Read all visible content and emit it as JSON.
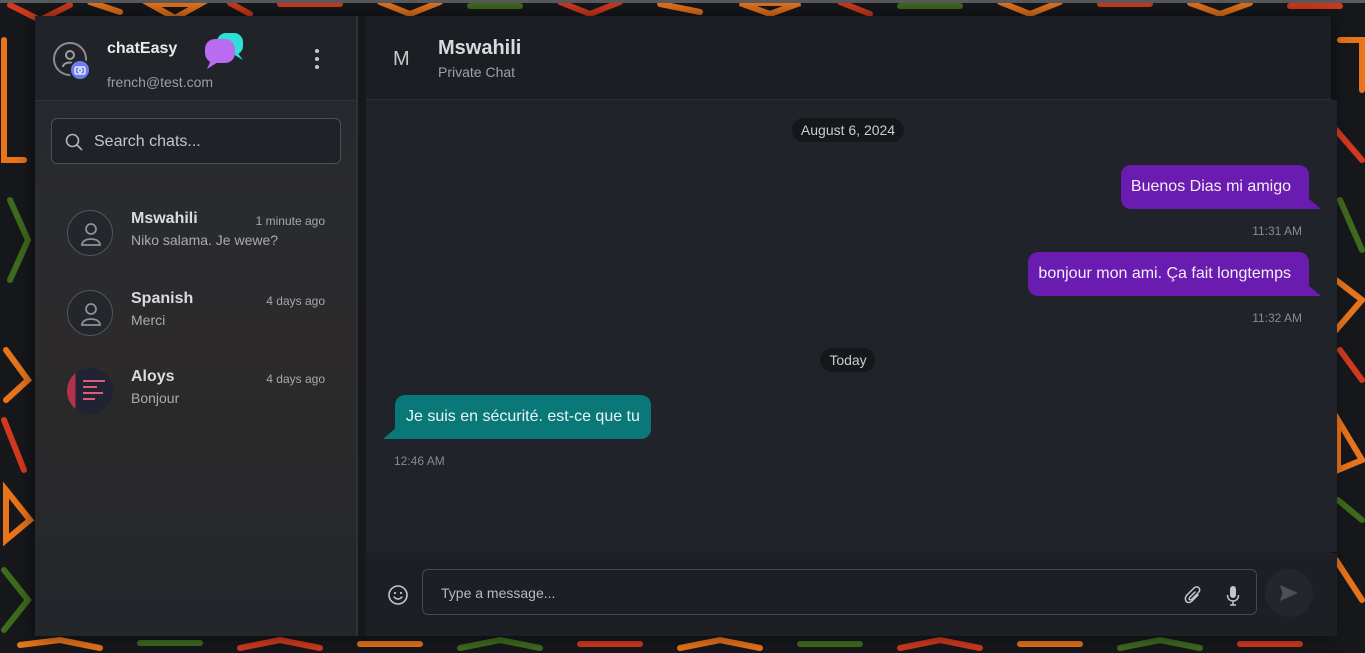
{
  "sidebar": {
    "app_name": "chatEasy",
    "user_email": "french@test.com",
    "search_placeholder": "Search chats...",
    "chats": [
      {
        "name": "Mswahili",
        "time": "1 minute ago",
        "preview": "Niko salama. Je wewe?"
      },
      {
        "name": "Spanish",
        "time": "4 days ago",
        "preview": "Merci"
      },
      {
        "name": "Aloys",
        "time": "4 days ago",
        "preview": "Bonjour"
      }
    ]
  },
  "conversation": {
    "initial": "M",
    "name": "Mswahili",
    "subtitle": "Private Chat",
    "dates": [
      "August 6, 2024",
      "Today"
    ],
    "messages": [
      {
        "text": "Buenos Dias mi amigo",
        "time": "11:31 AM",
        "direction": "outgoing"
      },
      {
        "text": "bonjour mon ami. Ça fait longtemps",
        "time": "11:32 AM",
        "direction": "outgoing"
      },
      {
        "text": "Je suis en sécurité. est-ce que tu",
        "time": "12:46 AM",
        "direction": "incoming"
      }
    ]
  },
  "composer": {
    "placeholder": "Type a message..."
  },
  "colors": {
    "outgoing_bubble": "#6a1bb0",
    "incoming_bubble": "#0a7878",
    "badge": "#6f7df2"
  },
  "icons": [
    "user-icon",
    "camera-icon",
    "chat-logo-icon",
    "more-vertical-icon",
    "search-icon",
    "emoji-icon",
    "paperclip-icon",
    "microphone-icon",
    "send-icon"
  ]
}
